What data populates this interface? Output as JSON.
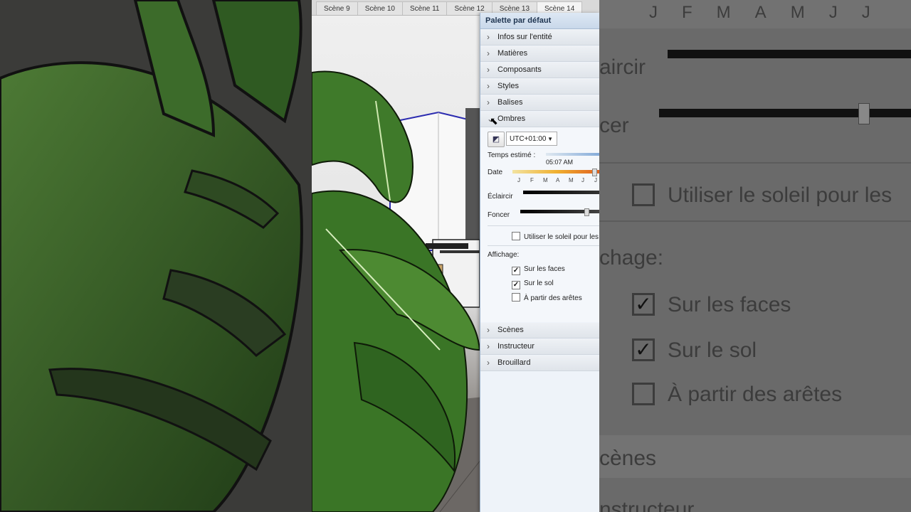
{
  "scene_tabs": [
    "Scène 9",
    "Scène 10",
    "Scène 11",
    "Scène 12",
    "Scène 13",
    "Scène 14"
  ],
  "active_tab_index": 5,
  "panel": {
    "title": "Palette par défaut",
    "sections_before": [
      "Infos sur l'entité",
      "Matières",
      "Composants",
      "Styles",
      "Balises"
    ],
    "shadows_section": "Ombres",
    "sections_after": [
      "Scènes",
      "Instructeur",
      "Brouillard"
    ]
  },
  "shadows": {
    "timezone": "UTC+01:00",
    "time_label": "Temps estimé :",
    "time_value": "05:07 AM",
    "date_label": "Date",
    "months": [
      "J",
      "F",
      "M",
      "A",
      "M",
      "J",
      "J"
    ],
    "lighten_label": "Éclaircir",
    "darken_label": "Foncer",
    "darken_level": 0.82,
    "use_sun_label": "Utiliser le soleil pour les",
    "use_sun_checked": false,
    "display_label": "Affichage:",
    "display_options": [
      {
        "label": "Sur les faces",
        "checked": true
      },
      {
        "label": "Sur le sol",
        "checked": true
      },
      {
        "label": "À partir des arêtes",
        "checked": false
      }
    ]
  },
  "zoom_right": {
    "months": [
      "J",
      "F",
      "M",
      "A",
      "M",
      "J",
      "J"
    ],
    "lighten_partial": "aircir",
    "darken_partial": "cer",
    "use_sun": "Utiliser le soleil pour les",
    "display_partial": "chage:",
    "options": [
      "Sur les faces",
      "Sur le sol",
      "À partir des arêtes"
    ],
    "scenes_partial": "cènes",
    "instructor_partial": "nstructeur"
  },
  "colors": {
    "panel_bg": "#eef3f9",
    "title_text": "#1e3450",
    "leaf_green": "#3f7a2a"
  }
}
